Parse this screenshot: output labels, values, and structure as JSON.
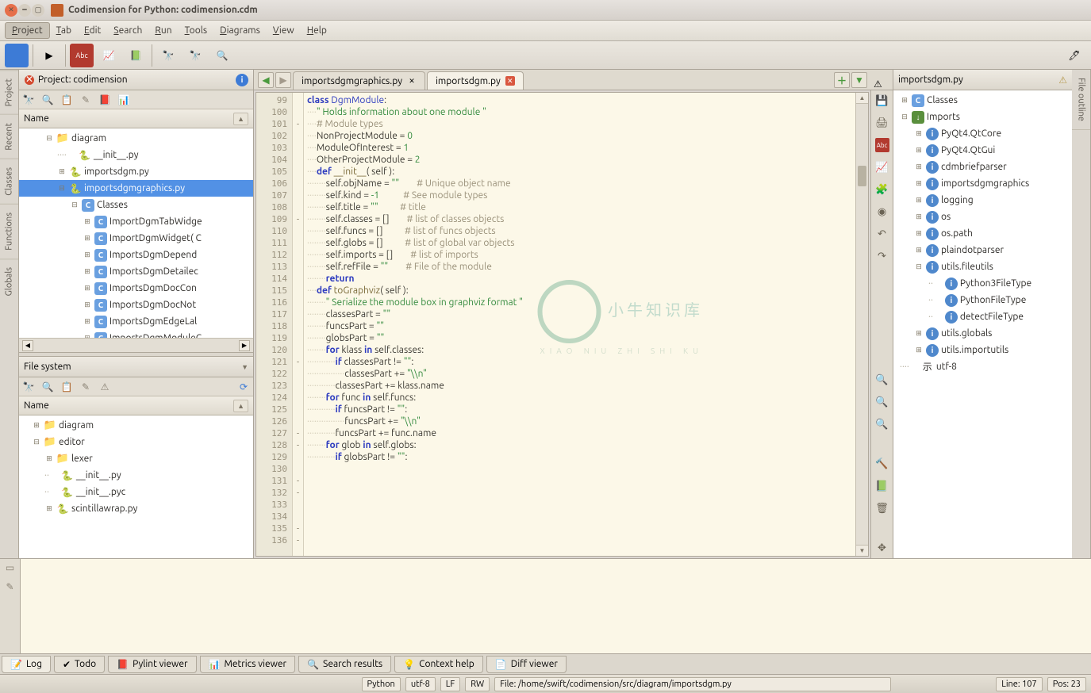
{
  "window": {
    "title": "Codimension for Python: codimension.cdm"
  },
  "menubar": [
    "Project",
    "Tab",
    "Edit",
    "Search",
    "Run",
    "Tools",
    "Diagrams",
    "View",
    "Help"
  ],
  "sidetabs_left": [
    "Project",
    "Recent",
    "Classes",
    "Functions",
    "Globals"
  ],
  "sidetabs_right": [
    "File outline"
  ],
  "project_panel": {
    "title": "Project: codimension",
    "column": "Name",
    "tree": [
      {
        "indent": 2,
        "tog": "⊟",
        "icon": "folder",
        "label": "diagram"
      },
      {
        "indent": 3,
        "tog": "",
        "dots": "····",
        "icon": "py",
        "label": "__init__.py"
      },
      {
        "indent": 3,
        "tog": "⊞",
        "icon": "py",
        "label": "importsdgm.py"
      },
      {
        "indent": 3,
        "tog": "⊟",
        "icon": "py",
        "label": "importsdgmgraphics.py",
        "selected": true
      },
      {
        "indent": 4,
        "tog": "⊟",
        "icon": "cls",
        "label": "Classes"
      },
      {
        "indent": 5,
        "tog": "⊞",
        "icon": "cls",
        "label": "ImportDgmTabWidge"
      },
      {
        "indent": 5,
        "tog": "⊞",
        "icon": "cls",
        "label": "ImportDgmWidget( C"
      },
      {
        "indent": 5,
        "tog": "⊞",
        "icon": "cls",
        "label": "ImportsDgmDepend"
      },
      {
        "indent": 5,
        "tog": "⊞",
        "icon": "cls",
        "label": "ImportsDgmDetailec"
      },
      {
        "indent": 5,
        "tog": "⊞",
        "icon": "cls",
        "label": "ImportsDgmDocCon"
      },
      {
        "indent": 5,
        "tog": "⊞",
        "icon": "cls",
        "label": "ImportsDgmDocNot"
      },
      {
        "indent": 5,
        "tog": "⊞",
        "icon": "cls",
        "label": "ImportsDgmEdgeLal"
      },
      {
        "indent": 5,
        "tog": "⊞",
        "icon": "cls",
        "label": "ImportsDgmModuleC"
      }
    ]
  },
  "fs_panel": {
    "title": "File system",
    "column": "Name",
    "tree": [
      {
        "indent": 1,
        "tog": "⊞",
        "icon": "folder",
        "label": "diagram"
      },
      {
        "indent": 1,
        "tog": "⊟",
        "icon": "folder",
        "label": "editor"
      },
      {
        "indent": 2,
        "tog": "⊞",
        "icon": "folder",
        "label": "lexer"
      },
      {
        "indent": 2,
        "tog": "",
        "dots": "··",
        "icon": "py",
        "label": "__init__.py"
      },
      {
        "indent": 2,
        "tog": "",
        "dots": "··",
        "icon": "py",
        "label": "__init__.pyc"
      },
      {
        "indent": 2,
        "tog": "⊞",
        "icon": "py",
        "label": "scintillawrap.py"
      }
    ]
  },
  "tabs": [
    {
      "label": "importsdgmgraphics.py",
      "active": false,
      "close": "x"
    },
    {
      "label": "importsdgm.py",
      "active": true,
      "close": "red"
    }
  ],
  "editor": {
    "first_line": 99,
    "fold": [
      "",
      "",
      "-",
      "",
      "",
      "",
      "",
      "",
      "",
      "",
      "-",
      "",
      "",
      "",
      "",
      "",
      "",
      "",
      "",
      "",
      "",
      "",
      "-",
      "",
      "",
      "",
      "",
      "",
      "-",
      "-",
      "",
      "",
      "-",
      "-",
      "",
      "",
      "-",
      "-"
    ],
    "lines": [
      "",
      "",
      "<kw>class</kw> <cls>DgmModule</cls>:",
      "<ws>····</ws><str>\" Holds information about one module \"</str>",
      "",
      "<ws>····</ws><cmt># Module types</cmt>",
      "<ws>····</ws>NonProjectModule = <num>0</num>",
      "<ws>····</ws>ModuleOfInterest = <num>1</num>",
      "<ws>····</ws>OtherProjectModule = <num>2</num>",
      "",
      "<ws>····</ws><kw>def</kw> <fn>__init__</fn>( <self>self</self> ):",
      "<ws>········</ws><self>self</self>.objName = <str>\"\"</str>        <cmt># Unique object name</cmt>",
      "<ws>········</ws><self>self</self>.kind = <num>-1</num>           <cmt># See module types</cmt>",
      "<ws>········</ws><self>self</self>.title = <str>\"\"</str>          <cmt># title</cmt>",
      "<ws>········</ws><self>self</self>.classes = []        <cmt># list of classes objects</cmt>",
      "<ws>········</ws><self>self</self>.funcs = []          <cmt># list of funcs objects</cmt>",
      "<ws>········</ws><self>self</self>.globs = []          <cmt># list of global var objects</cmt>",
      "<ws>········</ws><self>self</self>.imports = []        <cmt># list of imports</cmt>",
      "",
      "<ws>········</ws><self>self</self>.refFile = <str>\"\"</str>        <cmt># File of the module</cmt>",
      "<ws>········</ws><kw>return</kw>",
      "",
      "<ws>····</ws><kw>def</kw> <fn>toGraphviz</fn>( <self>self</self> ):",
      "<ws>········</ws><str>\" Serialize the module box in graphviz format \"</str>",
      "<ws>········</ws>classesPart = <str>\"\"</str>",
      "<ws>········</ws>funcsPart = <str>\"\"</str>",
      "<ws>········</ws>globsPart = <str>\"\"</str>",
      "",
      "<ws>········</ws><kw>for</kw> klass <kw>in</kw> <self>self</self>.classes:",
      "<ws>············</ws><kw>if</kw> classesPart != <str>\"\"</str>:",
      "<ws>················</ws>classesPart += <str>\"\\\\n\"</str>",
      "<ws>············</ws>classesPart += klass.name",
      "<ws>········</ws><kw>for</kw> func <kw>in</kw> <self>self</self>.funcs:",
      "<ws>············</ws><kw>if</kw> funcsPart != <str>\"\"</str>:",
      "<ws>················</ws>funcsPart += <str>\"\\\\n\"</str>",
      "<ws>············</ws>funcsPart += func.name",
      "<ws>········</ws><kw>for</kw> glob <kw>in</kw> <self>self</self>.globs:",
      "<ws>············</ws><kw>if</kw> globsPart != <str>\"\"</str>:"
    ]
  },
  "outline": {
    "title": "importsdgm.py",
    "rows": [
      {
        "indent": 0,
        "tog": "⊞",
        "icon": "cls",
        "label": "Classes"
      },
      {
        "indent": 0,
        "tog": "⊟",
        "icon": "import",
        "label": "Imports"
      },
      {
        "indent": 1,
        "tog": "⊞",
        "icon": "mod",
        "label": "PyQt4.QtCore"
      },
      {
        "indent": 1,
        "tog": "⊞",
        "icon": "mod",
        "label": "PyQt4.QtGui"
      },
      {
        "indent": 1,
        "tog": "⊞",
        "icon": "mod",
        "label": "cdmbriefparser"
      },
      {
        "indent": 1,
        "tog": "⊞",
        "icon": "mod",
        "label": "importsdgmgraphics"
      },
      {
        "indent": 1,
        "tog": "⊞",
        "icon": "mod",
        "label": "logging"
      },
      {
        "indent": 1,
        "tog": "⊞",
        "icon": "mod",
        "label": "os"
      },
      {
        "indent": 1,
        "tog": "⊞",
        "icon": "mod",
        "label": "os.path"
      },
      {
        "indent": 1,
        "tog": "⊞",
        "icon": "mod",
        "label": "plaindotparser"
      },
      {
        "indent": 1,
        "tog": "⊟",
        "icon": "mod",
        "label": "utils.fileutils"
      },
      {
        "indent": 2,
        "tog": "",
        "dots": "··",
        "icon": "mod",
        "label": "Python3FileType"
      },
      {
        "indent": 2,
        "tog": "",
        "dots": "··",
        "icon": "mod",
        "label": "PythonFileType"
      },
      {
        "indent": 2,
        "tog": "",
        "dots": "··",
        "icon": "mod",
        "label": "detectFileType"
      },
      {
        "indent": 1,
        "tog": "⊞",
        "icon": "mod",
        "label": "utils.globals"
      },
      {
        "indent": 1,
        "tog": "⊞",
        "icon": "mod",
        "label": "utils.importutils"
      },
      {
        "indent": 0,
        "tog": "",
        "dots": "····",
        "icon": "enc",
        "label": "utf-8"
      }
    ]
  },
  "bottom_tabs": [
    {
      "icon": "📝",
      "label": "Log",
      "active": true
    },
    {
      "icon": "✔",
      "label": "Todo"
    },
    {
      "icon": "📕",
      "label": "Pylint viewer"
    },
    {
      "icon": "📊",
      "label": "Metrics viewer"
    },
    {
      "icon": "🔍",
      "label": "Search results"
    },
    {
      "icon": "💡",
      "label": "Context help"
    },
    {
      "icon": "📄",
      "label": "Diff viewer"
    }
  ],
  "status": {
    "lang": "Python",
    "enc": "utf-8",
    "eol": "LF",
    "mode": "RW",
    "file": "File: /home/swift/codimension/src/diagram/importsdgm.py",
    "line": "Line: 107",
    "pos": "Pos: 23"
  }
}
